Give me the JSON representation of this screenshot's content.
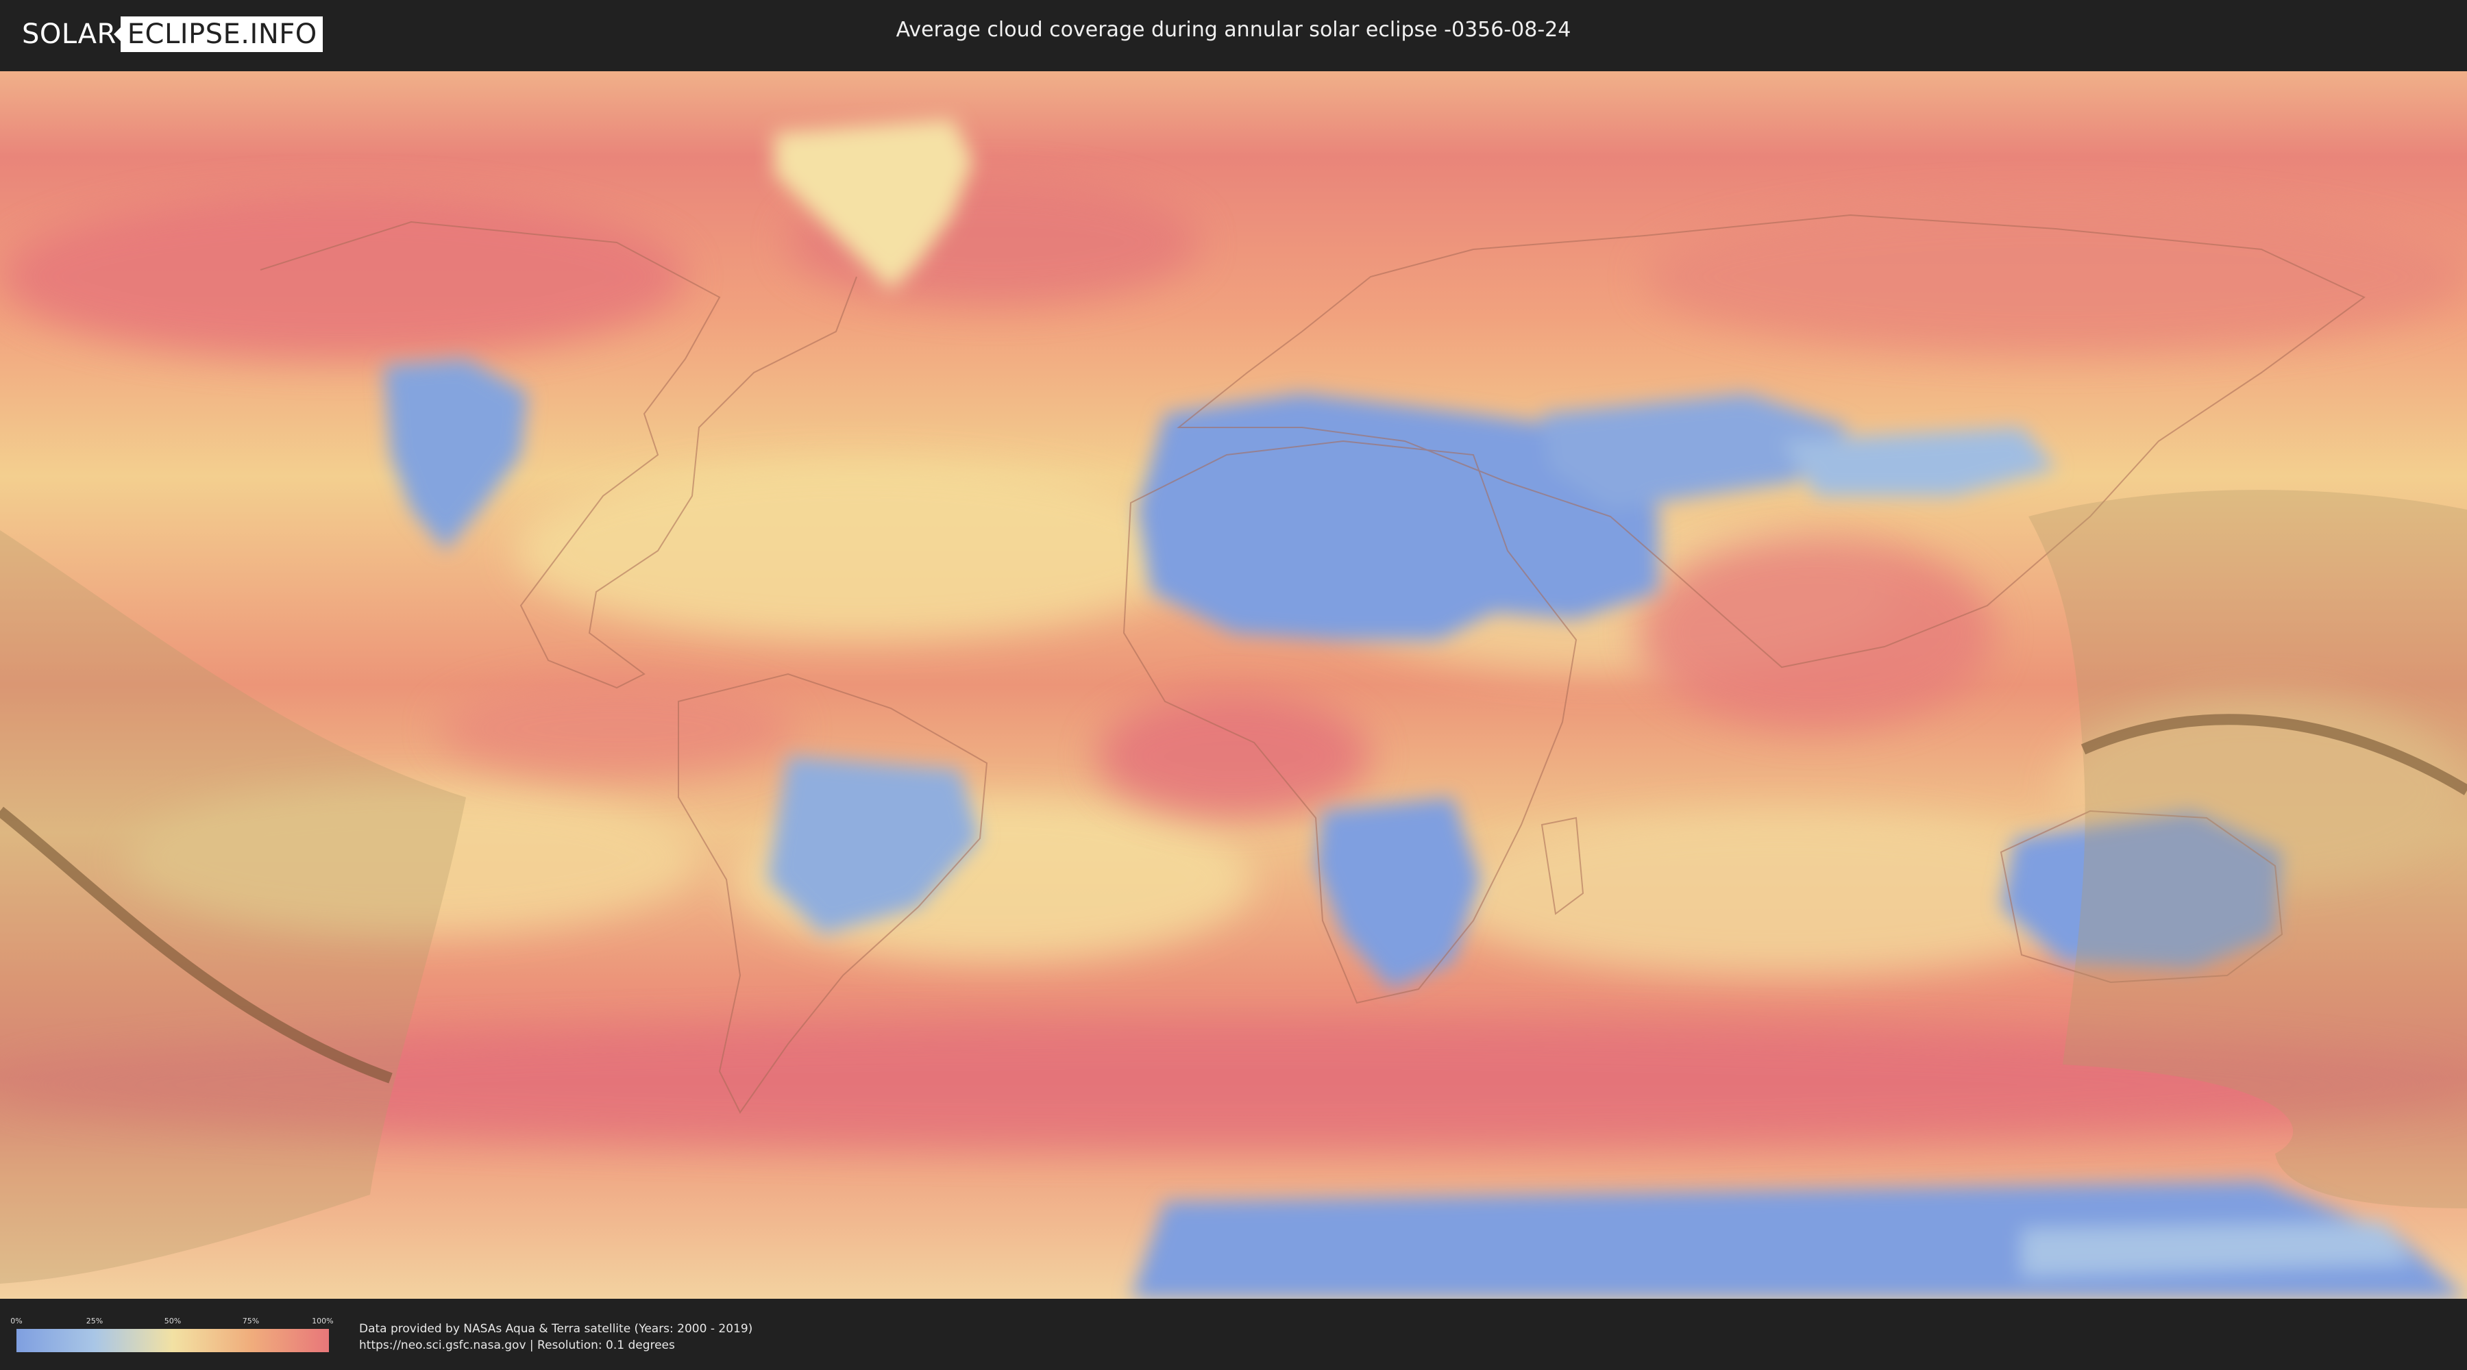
{
  "header": {
    "logo_left": "SOLAR",
    "logo_right": "ECLIPSE.INFO",
    "title": "Average cloud coverage during annular solar eclipse -0356-08-24"
  },
  "map": {
    "projection": "equirectangular world map",
    "layer": "average cloud coverage",
    "overlay": "eclipse path zone with central line"
  },
  "legend": {
    "ticks": [
      "0%",
      "25%",
      "50%",
      "75%",
      "100%"
    ],
    "colors": [
      "#7f9fe0",
      "#a9c6e6",
      "#f2e1a3",
      "#f0ad7c",
      "#e8777a"
    ]
  },
  "footer": {
    "source_line": "Data provided by NASAs Aqua & Terra satellite (Years: 2000 - 2019)",
    "info_line": "https://neo.sci.gsfc.nasa.gov | Resolution: 0.1 degrees"
  }
}
